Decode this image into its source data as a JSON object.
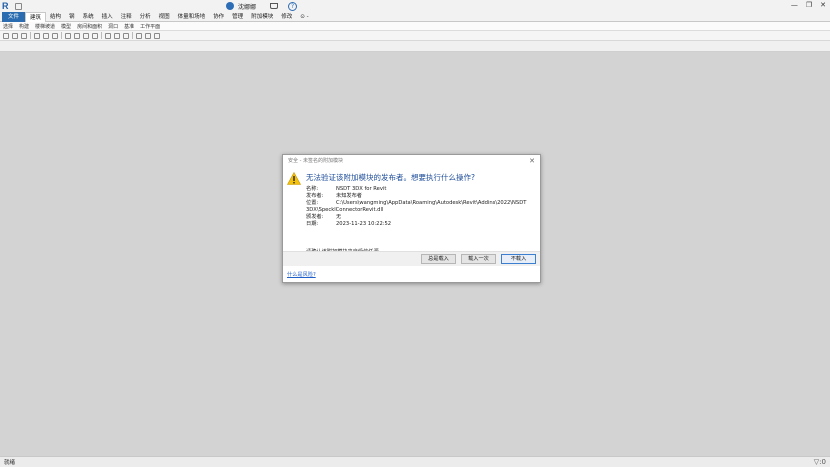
{
  "app": {
    "logo": "R",
    "user_name": "沈娜娜",
    "help_symbol": "?",
    "controls": {
      "minimize": "—",
      "restore": "❐",
      "close": "✕"
    }
  },
  "ribbon": {
    "tabs": [
      {
        "label": "文件"
      },
      {
        "label": "建筑"
      },
      {
        "label": "结构"
      },
      {
        "label": "钢"
      },
      {
        "label": "系统"
      },
      {
        "label": "插入"
      },
      {
        "label": "注释"
      },
      {
        "label": "分析"
      },
      {
        "label": "视图"
      },
      {
        "label": "体量和场地"
      },
      {
        "label": "协作"
      },
      {
        "label": "管理"
      },
      {
        "label": "附加模块"
      },
      {
        "label": "修改"
      },
      {
        "label": "⊙ -"
      }
    ],
    "panels": [
      {
        "label": "选择"
      },
      {
        "label": "构建"
      },
      {
        "label": "楼梯坡道"
      },
      {
        "label": "模型"
      },
      {
        "label": "房间和面积"
      },
      {
        "label": "洞口"
      },
      {
        "label": "基准"
      },
      {
        "label": "工作平面"
      }
    ]
  },
  "status": {
    "text": "就绪",
    "filter": "▽:0"
  },
  "dialog": {
    "title": "安全 - 未签名的附加模块",
    "close": "✕",
    "heading": "无法验证该附加模块的发布者。想要执行什么操作?",
    "fields": [
      {
        "key": "名称:",
        "value": "NSDT 3DX for Revit"
      },
      {
        "key": "发布者:",
        "value": "未知发布者"
      },
      {
        "key": "位置:",
        "value": "C:\\Users\\wangming\\AppData\\Roaming\\Autodesk\\Revit\\Addins\\2022\\NSDT"
      }
    ],
    "location_cont": "3DX\\SpecklConnectorRevit.dll",
    "fields2": [
      {
        "key": "颁发者:",
        "value": "无"
      },
      {
        "key": "日期:",
        "value": "2023-11-23 10:22:52"
      }
    ],
    "hint": "请确认该附加模块来自受信任源。",
    "buttons": {
      "always": "总是载入",
      "once": "载入一次",
      "never": "不载入"
    },
    "link": "什么是风险?"
  }
}
